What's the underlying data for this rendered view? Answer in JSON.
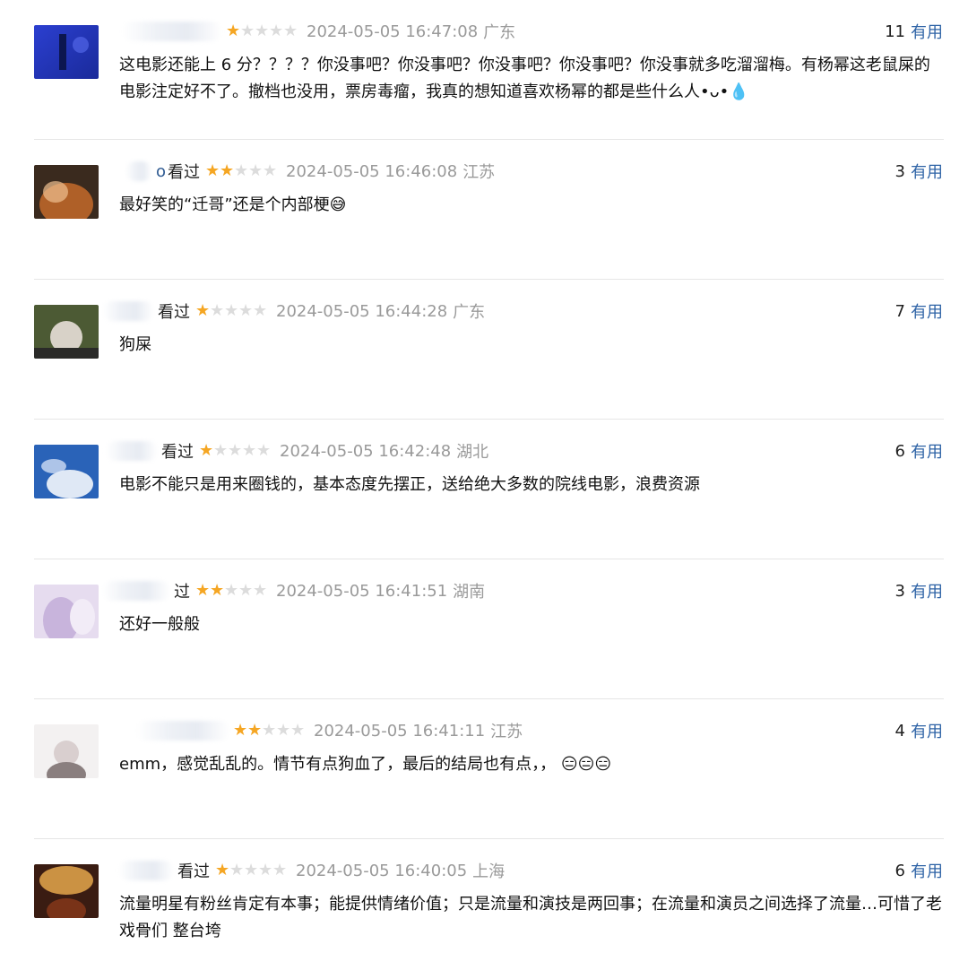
{
  "comments": [
    {
      "status": "",
      "name_tail": "",
      "stars": 1,
      "time": "2024-05-05 16:47:08",
      "location": "广东",
      "votes": "11",
      "useful_label": "有用",
      "text": "这电影还能上 6 分？？？？你没事吧？你没事吧？你没事吧？你没事吧？你没事就多吃溜溜梅。有杨幂这老鼠屎的电影注定好不了。撤档也没用，票房毒瘤，我真的想知道喜欢杨幂的都是些什么人•ᴗ•💧"
    },
    {
      "status": "看过",
      "name_tail": "o",
      "stars": 2,
      "time": "2024-05-05 16:46:08",
      "location": "江苏",
      "votes": "3",
      "useful_label": "有用",
      "text": "最好笑的“迁哥”还是个内部梗😅"
    },
    {
      "status": "看过",
      "name_tail": "",
      "stars": 1,
      "time": "2024-05-05 16:44:28",
      "location": "广东",
      "votes": "7",
      "useful_label": "有用",
      "text": "狗屎"
    },
    {
      "status": "看过",
      "name_tail": "",
      "stars": 1,
      "time": "2024-05-05 16:42:48",
      "location": "湖北",
      "votes": "6",
      "useful_label": "有用",
      "text": "电影不能只是用来圈钱的，基本态度先摆正，送给绝大多数的院线电影，浪费资源"
    },
    {
      "status": "过",
      "name_tail": "",
      "stars": 2,
      "time": "2024-05-05 16:41:51",
      "location": "湖南",
      "votes": "3",
      "useful_label": "有用",
      "text": "还好一般般"
    },
    {
      "status": "",
      "name_tail": "",
      "stars": 2,
      "time": "2024-05-05 16:41:11",
      "location": "江苏",
      "votes": "4",
      "useful_label": "有用",
      "text": "emm，感觉乱乱的。情节有点狗血了，最后的结局也有点，， 😑😑😑"
    },
    {
      "status": "看过",
      "name_tail": "",
      "stars": 1,
      "time": "2024-05-05 16:40:05",
      "location": "上海",
      "votes": "6",
      "useful_label": "有用",
      "text": "流量明星有粉丝肯定有本事；能提供情绪价值；只是流量和演技是两回事；在流量和演员之间选择了流量…可惜了老戏骨们 整台垮"
    }
  ],
  "colors": {
    "star_on": "#f5a623",
    "star_off": "#dcdcdc",
    "link": "#2e63a6",
    "meta_gray": "#9a9a9a"
  }
}
